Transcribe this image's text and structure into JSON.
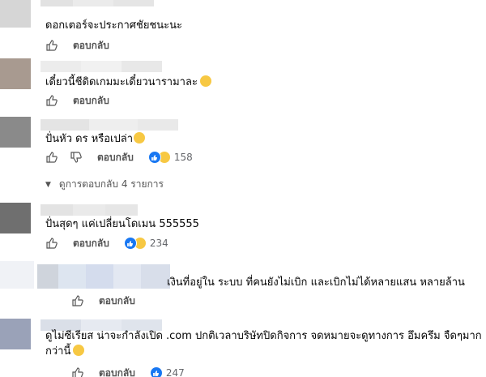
{
  "comments": [
    {
      "text": "ดอกเตอร์จะประกาศชัยชนะนะ",
      "reply_label": "ตอบกลับ",
      "avatar_color": "#d6d6d6"
    },
    {
      "text": "เดี๋ยวนี้ชีดิดเกมมะเดี๋ยวนารามาละ",
      "reply_label": "ตอบกลับ",
      "avatar_color": "#a89a90",
      "emoji": "haha"
    },
    {
      "text": "ปั่นหัว ดร หรือเปล่า",
      "reply_label": "ตอบกลับ",
      "avatar_color": "#8a8a8a",
      "emoji": "rofl",
      "reaction_count": "158"
    },
    {
      "text": "ปั่นสุดๆ แค่เปลี่ยนโดเมน 555555",
      "reply_label": "ตอบกลับ",
      "avatar_color": "#6f6f6f",
      "reaction_count": "234"
    },
    {
      "text": "เงินที่อยู่ใน ระบบ ที่คนยังไม่เบิก และเบิกไม่ได้หลายแสน หลายล้าน",
      "reply_label": "ตอบกลับ",
      "avatar_color": "#dfe3ea"
    },
    {
      "text_line1": "ดูไม่ซีเรียส น่าจะกำลังเปิด .com ปกติเวลาบริษัทปิดกิจการ จดหมายจะดูทางการ อึมครึม จืดๆมาก",
      "text_line2": "กว่านี้",
      "reply_label": "ตอบกลับ",
      "avatar_color": "#9aa2b8",
      "reaction_count": "247"
    }
  ],
  "view_replies": "ดูการตอบกลับ 4 รายการ",
  "colors": {
    "like_blue": "#1877f2",
    "haha_yellow": "#f7c843",
    "muted": "#65676b"
  }
}
